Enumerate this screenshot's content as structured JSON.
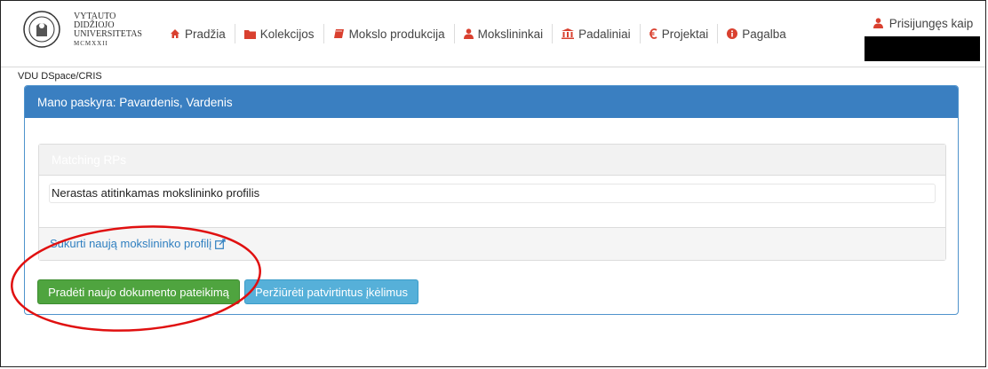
{
  "brand": {
    "line1": "VYTAUTO",
    "line2": "DIDŽIOJO",
    "line3": "UNIVERSITETAS",
    "line4": "MCMXXII"
  },
  "nav": {
    "items": [
      {
        "label": "Pradžia",
        "icon": "home-icon"
      },
      {
        "label": "Kolekcijos",
        "icon": "folder-icon"
      },
      {
        "label": "Mokslo produkcija",
        "icon": "book-icon"
      },
      {
        "label": "Mokslininkai",
        "icon": "user-icon"
      },
      {
        "label": "Padaliniai",
        "icon": "institution-icon"
      },
      {
        "label": "Projektai",
        "icon": "euro-icon"
      },
      {
        "label": "Pagalba",
        "icon": "info-icon"
      }
    ],
    "user_label": "Prisijungęs kaip"
  },
  "breadcrumb": "VDU DSpace/CRIS",
  "panel": {
    "title": "Mano paskyra: Pavardenis, Vardenis",
    "sub_title": "Matching RPs",
    "no_match": "Nerastas atitinkamas mokslininko profilis",
    "create_link": "Sukurti naują mokslininko profilį"
  },
  "buttons": {
    "start": "Pradėti naujo dokumento pateikimą",
    "view": "Peržiūrėti patvirtintus įkėlimus"
  },
  "colors": {
    "header_blue": "#3a7fc1",
    "button_green": "#4fa43f",
    "button_blue": "#56b0d9",
    "accent_red": "#d9402f",
    "annotation_red": "#e01010"
  }
}
